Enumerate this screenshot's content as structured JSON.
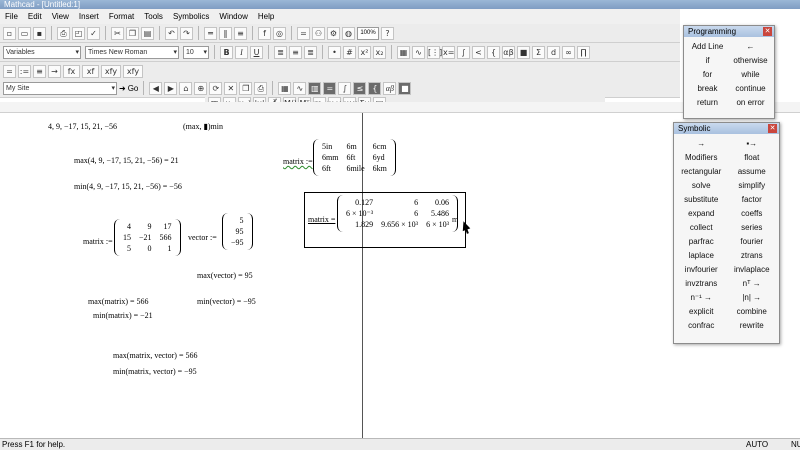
{
  "window": {
    "title": "Mathcad - [Untitled:1]"
  },
  "menu": [
    "File",
    "Edit",
    "View",
    "Insert",
    "Format",
    "Tools",
    "Symbolics",
    "Window",
    "Help"
  ],
  "toolbar": {
    "zoom": "100%",
    "style_select": "Variables",
    "font_select": "Times New Roman",
    "size_select": "10",
    "resource_select": "My Site",
    "go_label": "Go",
    "math_row": [
      "=",
      ":=",
      "≡",
      "→",
      "fx",
      "xf",
      "xfy",
      "xfy"
    ]
  },
  "worksheet": {
    "lines": {
      "list_args": "4, 9, −17, 15, 21, −56",
      "max_template": "(max, ▮)min",
      "max_eval": "max(4, 9, −17, 15, 21, −56) = 21",
      "min_eval": "min(4, 9, −17, 15, 21, −56) = −56",
      "matrix_def_label": "matrix :=",
      "vector_def_label": "vector :=",
      "max_vector": "max(vector) = 95",
      "max_matrix": "max(matrix) = 566",
      "min_vector": "min(vector) = −95",
      "min_matrix": "min(matrix) = −21",
      "max_mv": "max(matrix, vector) = 566",
      "min_mv": "min(matrix, vector) = −95",
      "units_def_label": "matrix :=",
      "units_eval_label": "matrix =",
      "units_eval_unit": "m"
    },
    "matrix": [
      [
        "4",
        "9",
        "17"
      ],
      [
        "15",
        "−21",
        "566"
      ],
      [
        "5",
        "0",
        "1"
      ]
    ],
    "vector": [
      "5",
      "95",
      "−95"
    ],
    "units_matrix": [
      [
        "5in",
        "6m",
        "6cm"
      ],
      [
        "6mm",
        "6ft",
        "6yd"
      ],
      [
        "6ft",
        "6mile",
        "6km"
      ]
    ],
    "result_matrix": [
      [
        "0.127",
        "6",
        "0.06"
      ],
      [
        "6 × 10⁻³",
        "6",
        "5.486"
      ],
      [
        "1.829",
        "9.656 × 10³",
        "6 × 10³"
      ]
    ]
  },
  "status": {
    "help": "Press F1 for help.",
    "mode": "AUTO",
    "num": "NU"
  },
  "programming_palette": {
    "title": "Programming",
    "items": [
      "Add Line",
      "←",
      "if",
      "otherwise",
      "for",
      "while",
      "break",
      "continue",
      "return",
      "on error"
    ]
  },
  "symbolic_palette": {
    "title": "Symbolic",
    "items": [
      "→",
      "▪→",
      "Modifiers",
      "float",
      "rectangular",
      "assume",
      "solve",
      "simplify",
      "substitute",
      "factor",
      "expand",
      "coeffs",
      "collect",
      "series",
      "parfrac",
      "fourier",
      "laplace",
      "ztrans",
      "invfourier",
      "invlaplace",
      "invztrans",
      "nᵀ →",
      "n⁻¹ →",
      "|n| →",
      "explicit",
      "combine",
      "confrac",
      "rewrite"
    ]
  }
}
